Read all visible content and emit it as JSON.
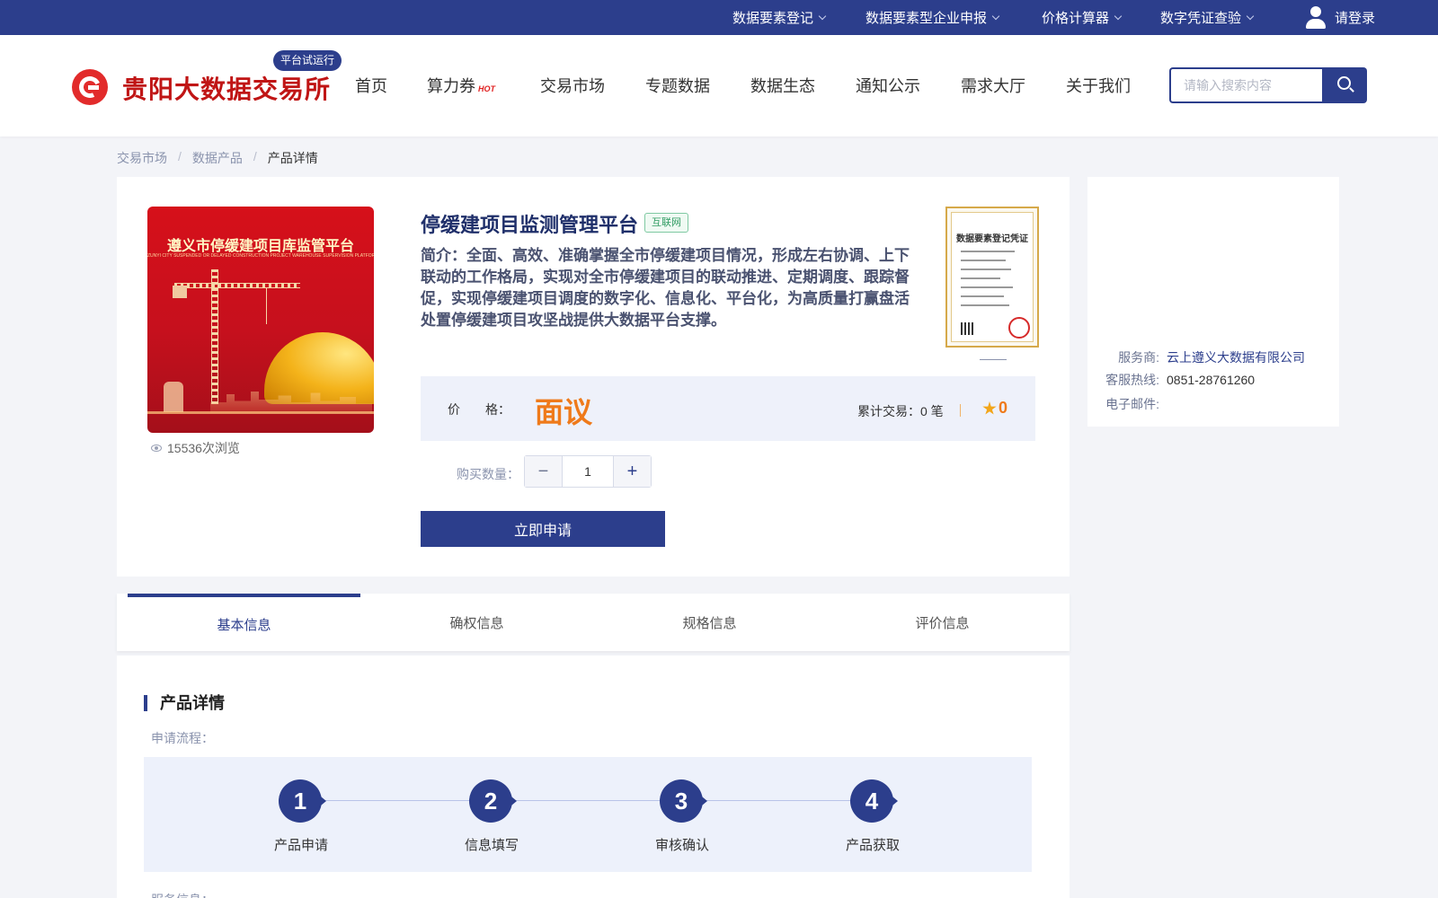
{
  "topbar": {
    "items": [
      {
        "label": "数据要素登记"
      },
      {
        "label": "数据要素型企业申报"
      },
      {
        "label": "价格计算器"
      },
      {
        "label": "数字凭证查验"
      }
    ],
    "login": "请登录"
  },
  "header": {
    "logo_text": "贵阳大数据交易所",
    "badge": "平台试运行",
    "nav": [
      {
        "label": "首页"
      },
      {
        "label": "算力券",
        "hot": "HOT"
      },
      {
        "label": "交易市场"
      },
      {
        "label": "专题数据"
      },
      {
        "label": "数据生态"
      },
      {
        "label": "通知公示"
      },
      {
        "label": "需求大厅"
      },
      {
        "label": "关于我们"
      }
    ],
    "search_placeholder": "请输入搜索内容"
  },
  "breadcrumb": [
    "交易市场",
    "数据产品",
    "产品详情"
  ],
  "product": {
    "image_banner": "遵义市停缓建项目库监管平台",
    "image_sub": "ZUNYI CITY SUSPENDED OR DELAYED CONSTRUCTION PROJECT WAREHOUSE SUPERVISION PLATFORM",
    "views": "15536次浏览",
    "title": "停缓建项目监测管理平台",
    "tag": "互联网",
    "description": "简介：全面、高效、准确掌握全市停缓建项目情况，形成左右协调、上下联动的工作格局，实现对全市停缓建项目的联动推进、定期调度、跟踪督促，实现停缓建项目调度的数字化、信息化、平台化，为高质量打赢盘活处置停缓建项目攻坚战提供大数据平台支撑。",
    "certificate_title": "数据要素登记凭证",
    "price_label": "价　　格：",
    "price": "面议",
    "trade_count": "累计交易：0 笔",
    "rating": "0",
    "qty_label": "购买数量：",
    "qty_minus": "−",
    "qty_value": "1",
    "qty_plus": "+",
    "apply": "立即申请"
  },
  "service": {
    "provider_label": "服务商:",
    "provider": "云上遵义大数据有限公司",
    "hotline_label": "客服热线:",
    "hotline": "0851-28761260",
    "email_label": "电子邮件:"
  },
  "tabs": [
    {
      "label": "基本信息",
      "active": true
    },
    {
      "label": "确权信息"
    },
    {
      "label": "规格信息"
    },
    {
      "label": "评价信息"
    }
  ],
  "detail": {
    "title": "产品详情",
    "flow_label": "申请流程：",
    "steps": [
      {
        "num": "1",
        "label": "产品申请"
      },
      {
        "num": "2",
        "label": "信息填写"
      },
      {
        "num": "3",
        "label": "审核确认"
      },
      {
        "num": "4",
        "label": "产品获取"
      }
    ],
    "next_label": "服务信息："
  },
  "colors": {
    "primary": "#2c3e8c",
    "brand_red": "#c01515",
    "price_orange": "#ef7a1a"
  }
}
